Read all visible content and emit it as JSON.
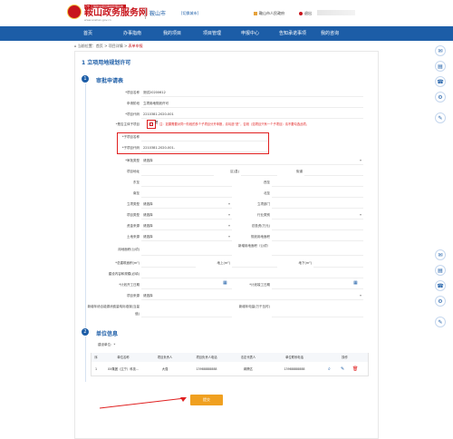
{
  "header": {
    "brand_top": "辽宁·工程建设项目审批管理系统",
    "brand_title": "鞍山政务服务网",
    "brand_url": "www.anshan.gov.cn",
    "city": "鞍山市",
    "city_switch": "[切换城市]",
    "gov_link": "鞍山市人民政府",
    "user_label": "退出"
  },
  "nav": {
    "items": [
      "首页",
      "办事指南",
      "我的项目",
      "项目管理",
      "申报中心",
      "告知承诺事项",
      "我的咨询"
    ]
  },
  "breadcrumb": {
    "prefix": "当前位置：",
    "home": "首页",
    "sep": " > ",
    "mid": "项目详情",
    "current": "表单申报"
  },
  "page": {
    "title": "1 立项用地规划许可"
  },
  "section1": {
    "step": "1",
    "title": "审批申请表"
  },
  "fields": {
    "project_name_label": "*项目名称",
    "project_name": "测试20200612",
    "stage_label": "申请阶段",
    "stage": "立项用地规划许可",
    "code_label": "*项目代码",
    "code": "2210381-2020-001",
    "is_sub_label": "*是否主体子项目",
    "is_sub_value": "是",
    "hint": "注：如果需要对同一阶段的多个子项目分开申报，请勾选“是”，否则（如项目只有一个子项目）请不要勾选此项。",
    "sub_name_label": "*子项目名称",
    "sub_name": "",
    "sub_code_label": "*子项目代码",
    "sub_code": "2210381-2020-001-",
    "type_label": "*审批类型",
    "type_value": "请选择",
    "address_label": "项目地址",
    "district_label": "区(县)",
    "street_label": "街道",
    "east_label": "东至",
    "west_label": "西至",
    "south_label": "南至",
    "north_label": "北至",
    "nature_label": "立项类型",
    "nature_value": "请选择",
    "dept_label": "立项部门",
    "proj_type_label": "项目类型",
    "proj_type_value": "请选择",
    "industry_label": "行业类别",
    "fund_label": "资金来源",
    "fund_value": "请选择",
    "invest_label": "总投资(万元)",
    "land_src_label": "土地来源",
    "land_src_value": "请选择",
    "plan_area_label": "规划用地面积",
    "land_area_label": "用地面积(公顷)",
    "new_land_label": "新增用地面积（公顷）",
    "build_area_label": "*总建筑面积(m²)",
    "above_label": "地上(m²)",
    "below_label": "地下(m²)",
    "scale_label": "建设内容和规模(必填)",
    "start_label": "*计划开工日期",
    "end_label": "*计划竣工日期",
    "source_label": "项目来源",
    "source_value": "请选择",
    "extra_label": "新增年综合能源消费量吨标准煤(当量值)",
    "extra2_label": "新增年电量(万千瓦时)"
  },
  "section2": {
    "step": "2",
    "title": "单位信息",
    "sub_label": "建设单位：*"
  },
  "unit_table": {
    "headers": [
      "序",
      "单位名称",
      "项目负责人",
      "项目负责人电话",
      "法定代表人",
      "单位联系电话",
      "操作"
    ],
    "rows": [
      [
        "1",
        "XX集团（辽宁）科技...",
        "大强",
        "13988888888",
        "蒋腾达",
        "13988888888",
        ""
      ]
    ]
  },
  "actions": {
    "submit": "提交"
  },
  "colors": {
    "brand": "#c8161d",
    "primary": "#1c5da7",
    "submit": "#f0a020",
    "alert": "#e02020"
  },
  "icons": [
    "search-icon",
    "edit-icon",
    "delete-icon",
    "calendar-icon",
    "home-icon"
  ]
}
